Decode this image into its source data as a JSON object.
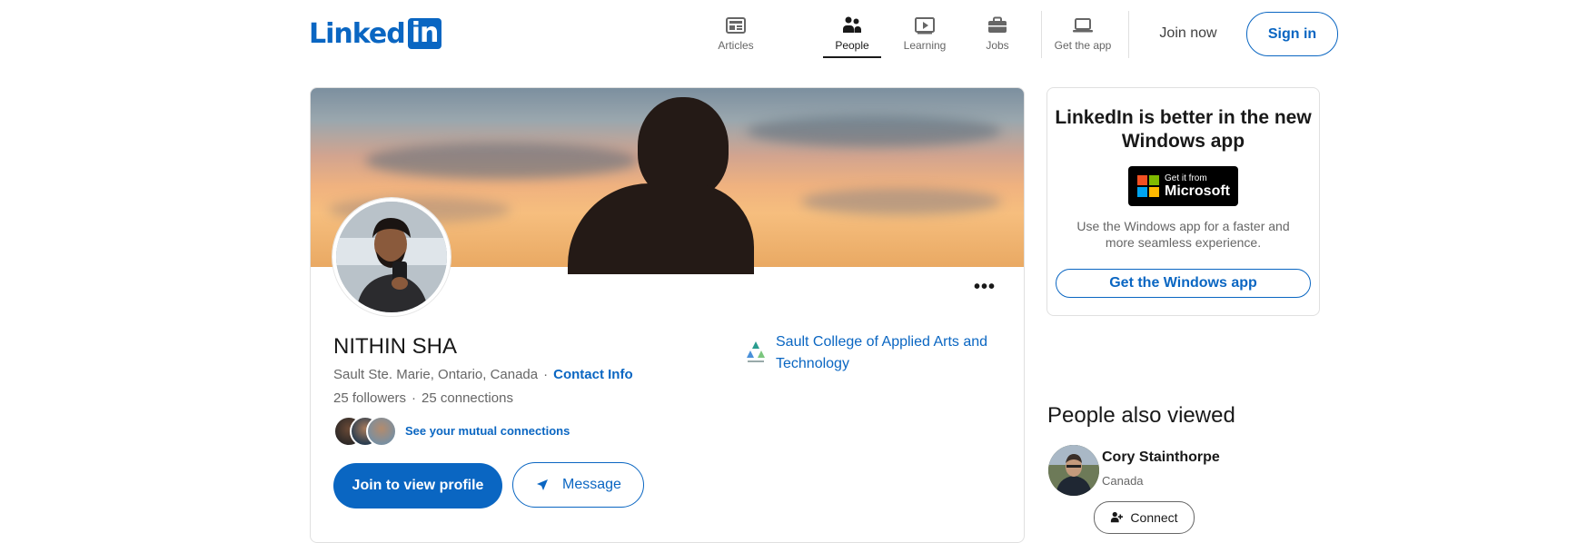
{
  "header": {
    "logo_text": "Linked",
    "logo_box_text": "in",
    "nav": [
      {
        "label": "Articles",
        "icon": "articles-icon"
      },
      {
        "label": "People",
        "icon": "people-icon",
        "active": true
      },
      {
        "label": "Learning",
        "icon": "learning-icon"
      },
      {
        "label": "Jobs",
        "icon": "jobs-icon"
      },
      {
        "label": "Get the app",
        "icon": "laptop-icon"
      }
    ],
    "join_now": "Join now",
    "sign_in": "Sign in"
  },
  "profile": {
    "more_label": "•••",
    "name": "NITHIN SHA",
    "location": "Sault Ste. Marie, Ontario, Canada",
    "separator": "·",
    "contact_info": "Contact Info",
    "followers": "25 followers",
    "connections": "25 connections",
    "mutual_link": "See your mutual connections",
    "join_button": "Join to view profile",
    "message_button": "Message",
    "school": "Sault College of Applied Arts and Technology"
  },
  "ad": {
    "title": "LinkedIn is better in the new Windows app",
    "badge_small": "Get it from",
    "badge_big": "Microsoft",
    "description": "Use the Windows app for a faster and more seamless experience.",
    "button": "Get the Windows app"
  },
  "people_also_viewed": {
    "title": "People also viewed",
    "items": [
      {
        "name": "Cory Stainthorpe",
        "location": "Canada",
        "button": "Connect"
      }
    ]
  },
  "colors": {
    "brand": "#0a66c2",
    "text": "#191919",
    "muted": "#666666"
  }
}
